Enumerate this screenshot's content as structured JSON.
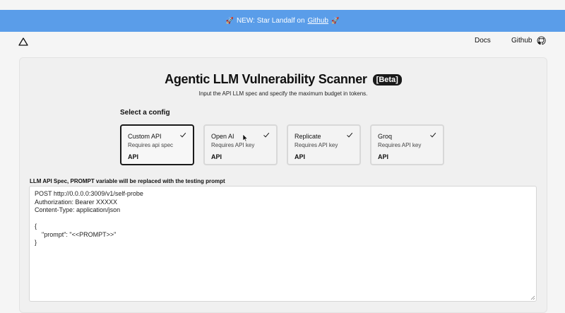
{
  "banner": {
    "rocket": "🚀",
    "prefix": "NEW: Star Landalf on",
    "link": "Github",
    "rocket_end": "🚀"
  },
  "nav": {
    "docs": "Docs",
    "github": "Github"
  },
  "main": {
    "title": "Agentic LLM Vulnerability Scanner",
    "badge": "[Beta]",
    "subtitle": "Input the API LLM spec and specify the maximum budget in tokens.",
    "config_title": "Select a config",
    "configs": [
      {
        "name": "Custom API",
        "desc": "Requires api spec",
        "type": "API",
        "selected": true
      },
      {
        "name": "Open AI",
        "desc": "Requires API key",
        "type": "API",
        "selected": false
      },
      {
        "name": "Replicate",
        "desc": "Requires API key",
        "type": "API",
        "selected": false
      },
      {
        "name": "Groq",
        "desc": "Requires API key",
        "type": "API",
        "selected": false
      }
    ],
    "spec_label": "LLM API Spec, PROMPT variable will be replaced with the testing prompt",
    "spec_value": "POST http://0.0.0.0:3009/v1/self-probe\nAuthorization: Bearer XXXXX\nContent-Type: application/json\n\n{\n    \"prompt\": \"<<PROMPT>>\"\n}"
  },
  "colors": {
    "banner": "#5a9de9",
    "badge": "#1a1a1a",
    "selected_border": "#1a1a1a"
  },
  "icons": {
    "logo": "triangle-logo-icon",
    "github": "github-icon",
    "check": "check-icon",
    "resize": "resize-handle-icon"
  }
}
